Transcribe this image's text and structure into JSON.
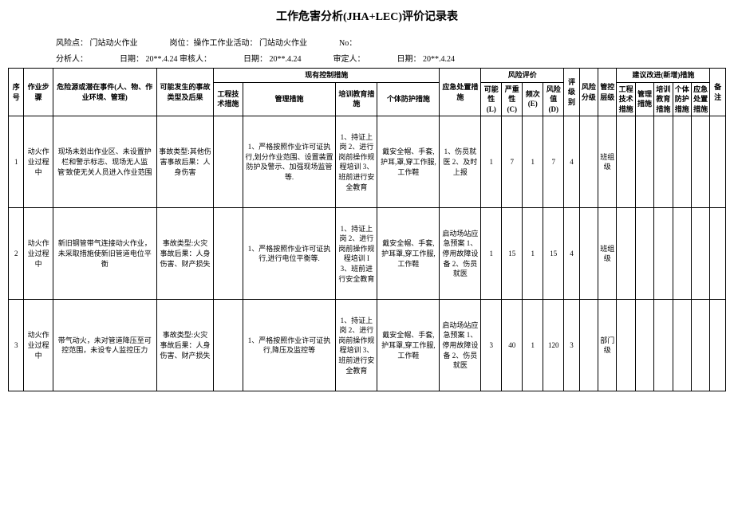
{
  "title": "工作危害分析(JHA+LEC)评价记录表",
  "header": {
    "risk_point_label": "风险点：",
    "risk_point_value": "门站动火作业",
    "post_label": "岗位：操作工作业活动：",
    "post_value": "门站动火作业",
    "no_label": "No：",
    "analyst_label": "分析人：",
    "date1_label": "日期：",
    "date1_value": "20**.4.24",
    "reviewer_label": "审核人：",
    "date2_label": "日期：",
    "date2_value": "20**.4.24",
    "approver_label": "审定人：",
    "date3_label": "日期：",
    "date3_value": "20**.4.24"
  },
  "columns": {
    "seq": "序号",
    "step": "作业步骤",
    "hazard": "危险源或潜在事件(人、物、作业环境、管理)",
    "accident": "可能发生的事故类型及后果",
    "existing_group": "现有控制措施",
    "tech": "工程技术措施",
    "mgmt": "管理措施",
    "train": "培训教育措施",
    "ppe": "个体防护措施",
    "emerg": "应急处置措施",
    "risk_group": "风险评价",
    "L": "可能性(L)",
    "C": "严重性(C)",
    "E": "频次(E)",
    "D": "风险值(D)",
    "grade": "评级别",
    "level": "风险分级",
    "class": "管控层级",
    "suggest_group": "建议改进(新增)措施",
    "sug_tech": "工程技术措施",
    "sug_mgmt": "管理措施",
    "sug_train": "培训教育措施",
    "sug_ppe": "个体防护措施",
    "sug_emerg": "应急处置措施",
    "note": "备注"
  },
  "rows": [
    {
      "seq": "1",
      "step": "动火作业过程中",
      "hazard": "现场未划出作业区、未设置护栏和警示标志、现场无人监管'致使无关人员进入作业范围",
      "accident": "事故类型:其他伤害事故后果：人身伤害",
      "tech": "",
      "mgmt": "1、严格按照作业许可证执行,划分作业范围、设置装置防护及警示、加强现场监管等.",
      "train": "1、持证上岗 2、进行岗前操作规程培训 3、班前进行安全教育",
      "ppe": "戴安全帽、手套,护耳,罩,穿工作服,工作鞋",
      "emerg": "1、伤员就医 2、及时上报",
      "L": "1",
      "C": "7",
      "E": "1",
      "D": "7",
      "grade": "4",
      "level": "",
      "class": "班组级",
      "sug_tech": "",
      "sug_mgmt": "",
      "sug_train": "",
      "sug_ppe": "",
      "sug_emerg": "",
      "note": ""
    },
    {
      "seq": "2",
      "step": "动火作业过程中",
      "hazard": "新旧钢管带气连接动火作业，未采取措施使新旧管道电位平衡",
      "accident": "事故类型:火灾 事故后果：人身伤害、财产损失",
      "tech": "",
      "mgmt": "1、严格按照作业许可证执行,进行电位平衡等.",
      "train": "1、持证上岗 2、进行岗前操作规程培训 I 3、班前进行安全教育",
      "ppe": "戴安全帽、手套,护耳罩,穿工作服,工作鞋",
      "emerg": "启动场站应急预案 1、停用故障设备 2、伤员就医",
      "L": "1",
      "C": "15",
      "E": "1",
      "D": "15",
      "grade": "4",
      "level": "",
      "class": "班组级",
      "sug_tech": "",
      "sug_mgmt": "",
      "sug_train": "",
      "sug_ppe": "",
      "sug_emerg": "",
      "note": ""
    },
    {
      "seq": "3",
      "step": "动火作业过程中",
      "hazard": "带气动火，未对管道降压至可控范围，未设专人监控压力",
      "accident": "事故类型:火灾 事故后果：人身伤害、财产损失",
      "tech": "",
      "mgmt": "1、严格按照作业许可证执行,降压及监控等",
      "train": "1、持证上岗 2、进行岗前操作规程培训 3、班前进行安全教育",
      "ppe": "戴安全帽、手套,护耳罩,穿工作服,工作鞋",
      "emerg": "启动场站应急预案 1、停用故障设备 2、伤员就医",
      "L": "3",
      "C": "40",
      "E": "1",
      "D": "120",
      "grade": "3",
      "level": "",
      "class": "部门级",
      "sug_tech": "",
      "sug_mgmt": "",
      "sug_train": "",
      "sug_ppe": "",
      "sug_emerg": "",
      "note": ""
    }
  ]
}
